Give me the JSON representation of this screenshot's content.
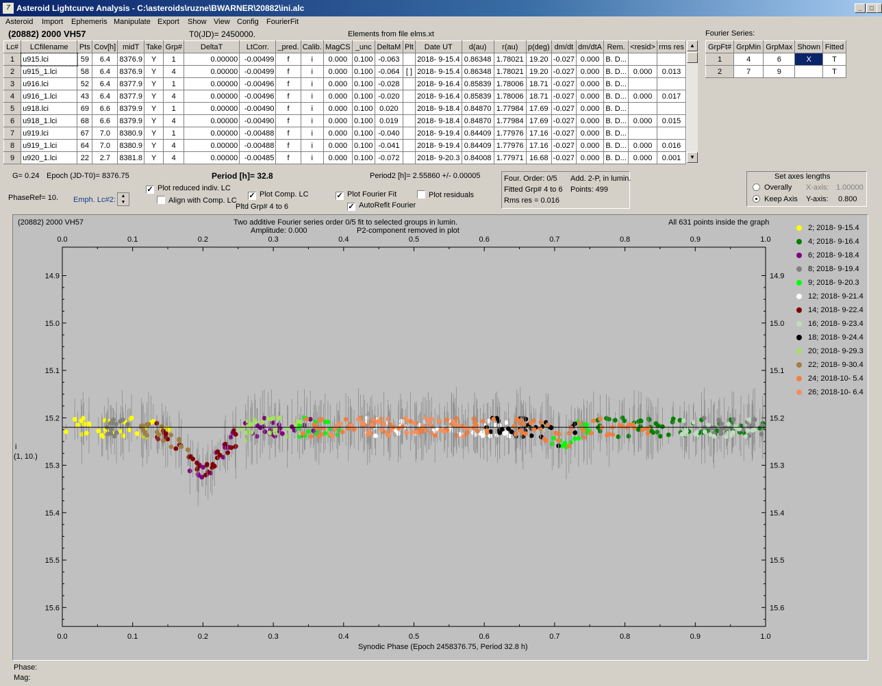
{
  "window": {
    "title": "Asteroid Lightcurve Analysis - C:\\asteroids\\ruzne\\BWARNER\\20882\\ini.alc",
    "icon": "app-icon",
    "min": "_",
    "max": "□",
    "close": "✕"
  },
  "menu": [
    "Asteroid",
    "Import",
    "Ephemeris",
    "Manipulate",
    "Export",
    "Show",
    "View",
    "Config",
    "FourierFit"
  ],
  "header": {
    "object": "(20882) 2000 VH57",
    "t0": "T0(JD)= 2450000.",
    "elements": "Elements from file elms.xt"
  },
  "table": {
    "columns": [
      "Lc#",
      "LCfilename",
      "Pts",
      "Cov[h]",
      "midT",
      "Take",
      "Grp#",
      "DeltaT",
      "LtCorr.",
      "_pred.",
      "Calib.",
      "MagCS",
      "_unc",
      "DeltaM",
      "Plt",
      "Date UT",
      "d(au)",
      "r(au)",
      "p(deg)",
      "dm/dt",
      "dm/dtA",
      "Rem.",
      "<resid>",
      "rms res"
    ],
    "rows": [
      [
        "1",
        "u915.lci",
        "59",
        "6.4",
        "8376.9",
        "Y",
        "1",
        "0.00000",
        "-0.00499",
        "f",
        "i",
        "0.000",
        "0.100",
        "-0.063",
        "",
        "2018- 9-15.4",
        "0.86348",
        "1.78021",
        "19.20",
        "-0.027",
        "0.000",
        "B. D...",
        "",
        ""
      ],
      [
        "2",
        "u915_1.lci",
        "58",
        "6.4",
        "8376.9",
        "Y",
        "4",
        "0.00000",
        "-0.00499",
        "f",
        "i",
        "0.000",
        "0.100",
        "-0.064",
        "[ ]",
        "2018- 9-15.4",
        "0.86348",
        "1.78021",
        "19.20",
        "-0.027",
        "0.000",
        "B. D...",
        "0.000",
        "0.013"
      ],
      [
        "3",
        "u916.lci",
        "52",
        "6.4",
        "8377.9",
        "Y",
        "1",
        "0.00000",
        "-0.00496",
        "f",
        "i",
        "0.000",
        "0.100",
        "-0.028",
        "",
        "2018- 9-16.4",
        "0.85839",
        "1.78006",
        "18.71",
        "-0.027",
        "0.000",
        "B. D...",
        "",
        ""
      ],
      [
        "4",
        "u916_1.lci",
        "43",
        "6.4",
        "8377.9",
        "Y",
        "4",
        "0.00000",
        "-0.00496",
        "f",
        "i",
        "0.000",
        "0.100",
        "-0.020",
        "",
        "2018- 9-16.4",
        "0.85839",
        "1.78006",
        "18.71",
        "-0.027",
        "0.000",
        "B. D...",
        "0.000",
        "0.017"
      ],
      [
        "5",
        "u918.lci",
        "69",
        "6.6",
        "8379.9",
        "Y",
        "1",
        "0.00000",
        "-0.00490",
        "f",
        "i",
        "0.000",
        "0.100",
        "0.020",
        "",
        "2018- 9-18.4",
        "0.84870",
        "1.77984",
        "17.69",
        "-0.027",
        "0.000",
        "B. D...",
        "",
        ""
      ],
      [
        "6",
        "u918_1.lci",
        "68",
        "6.6",
        "8379.9",
        "Y",
        "4",
        "0.00000",
        "-0.00490",
        "f",
        "i",
        "0.000",
        "0.100",
        "0.019",
        "",
        "2018- 9-18.4",
        "0.84870",
        "1.77984",
        "17.69",
        "-0.027",
        "0.000",
        "B. D...",
        "0.000",
        "0.015"
      ],
      [
        "7",
        "u919.lci",
        "67",
        "7.0",
        "8380.9",
        "Y",
        "1",
        "0.00000",
        "-0.00488",
        "f",
        "i",
        "0.000",
        "0.100",
        "-0.040",
        "",
        "2018- 9-19.4",
        "0.84409",
        "1.77976",
        "17.16",
        "-0.027",
        "0.000",
        "B. D...",
        "",
        ""
      ],
      [
        "8",
        "u919_1.lci",
        "64",
        "7.0",
        "8380.9",
        "Y",
        "4",
        "0.00000",
        "-0.00488",
        "f",
        "i",
        "0.000",
        "0.100",
        "-0.041",
        "",
        "2018- 9-19.4",
        "0.84409",
        "1.77976",
        "17.16",
        "-0.027",
        "0.000",
        "B. D...",
        "0.000",
        "0.016"
      ],
      [
        "9",
        "u920_1.lci",
        "22",
        "2.7",
        "8381.8",
        "Y",
        "4",
        "0.00000",
        "-0.00485",
        "f",
        "i",
        "0.000",
        "0.100",
        "-0.072",
        "",
        "2018- 9-20.3",
        "0.84008",
        "1.77971",
        "16.68",
        "-0.027",
        "0.000",
        "B. D...",
        "0.000",
        "0.001"
      ]
    ]
  },
  "fourier": {
    "title": "Fourier Series:",
    "columns": [
      "GrpFt#",
      "GrpMin",
      "GrpMax",
      "Shown",
      "Fitted"
    ],
    "rows": [
      [
        "1",
        "4",
        "6",
        "X",
        "T"
      ],
      [
        "2",
        "7",
        "9",
        "",
        "T"
      ]
    ]
  },
  "controls": {
    "g": "G= 0.24",
    "epoch": "Epoch (JD-T0)= 8376.75",
    "period": "Period [h]= 32.8",
    "period2": "Period2 [h]= 2.55860 +/- 0.00005",
    "phaseref": "PhaseRef= 10.",
    "emph": "Emph. Lc#2:",
    "plot_reduced": "Plot reduced indiv. LC",
    "align": "Align with Comp. LC",
    "plot_comp": "Plot Comp. LC",
    "pltd_grp": "Pltd Grp#  4   to    6",
    "plot_fourier": "Plot Fourier Fit",
    "autorefit": "AutoRefit Fourier",
    "plot_resid": "Plot residuals",
    "info1": "Four. Order:  0/5",
    "info2": "Add. 2-P, in lumin.",
    "info3": "Fitted Grp# 4 to 6",
    "info4": "Points: 499",
    "info5": "Rms res      = 0.016",
    "axes_title": "Set axes lengths",
    "overally": "Overally",
    "keep": "Keep Axis",
    "xaxis_lbl": "X-axis:",
    "xaxis_val": "1.00000",
    "yaxis_lbl": "Y-axis:",
    "yaxis_val": "0.800"
  },
  "plot": {
    "topleft": "(20882) 2000 VH57",
    "caption1": "Two additive Fourier series order 0/5 fit to selected groups in lumin.",
    "caption2": "Amplitude: 0.000",
    "caption3": "P2-component removed in plot",
    "topright": "All 631 points inside the graph",
    "ylabel1": "i",
    "ylabel2": "(1, 10.)",
    "xlabel": "Synodic Phase (Epoch 2458376.75, Period 32.8 h)"
  },
  "chart_data": {
    "type": "scatter",
    "xlim": [
      0,
      1
    ],
    "ylim": [
      15.64,
      14.84
    ],
    "x_ticks": [
      "0.0",
      "0.1",
      "0.2",
      "0.3",
      "0.4",
      "0.5",
      "0.6",
      "0.7",
      "0.8",
      "0.9",
      "1.0"
    ],
    "y_ticks": [
      "14.9",
      "15.0",
      "15.1",
      "15.2",
      "15.3",
      "15.4",
      "15.5",
      "15.6"
    ],
    "fit_level": 15.22,
    "series": [
      {
        "name": "2; 2018- 9-15.4",
        "color": "#ffff00"
      },
      {
        "name": "4; 2018- 9-16.4",
        "color": "#008000"
      },
      {
        "name": "6; 2018- 9-18.4",
        "color": "#800080"
      },
      {
        "name": "8; 2018- 9-19.4",
        "color": "#808080"
      },
      {
        "name": "9; 2018- 9-20.3",
        "color": "#00ff00"
      },
      {
        "name": "12; 2018- 9-21.4",
        "color": "#ffffff"
      },
      {
        "name": "14; 2018- 9-22.4",
        "color": "#800000"
      },
      {
        "name": "16; 2018- 9-23.4",
        "color": "#c0dcc0"
      },
      {
        "name": "18; 2018- 9-24.4",
        "color": "#000000"
      },
      {
        "name": "20; 2018- 9-29.3",
        "color": "#a6e060"
      },
      {
        "name": "22; 2018- 9-30.4",
        "color": "#a08040"
      },
      {
        "name": "24; 2018-10- 5.4",
        "color": "#f08040"
      },
      {
        "name": "26; 2018-10- 6.4",
        "color": "#f09060"
      }
    ]
  },
  "status": {
    "phase": "Phase:",
    "mag": "Mag:"
  }
}
